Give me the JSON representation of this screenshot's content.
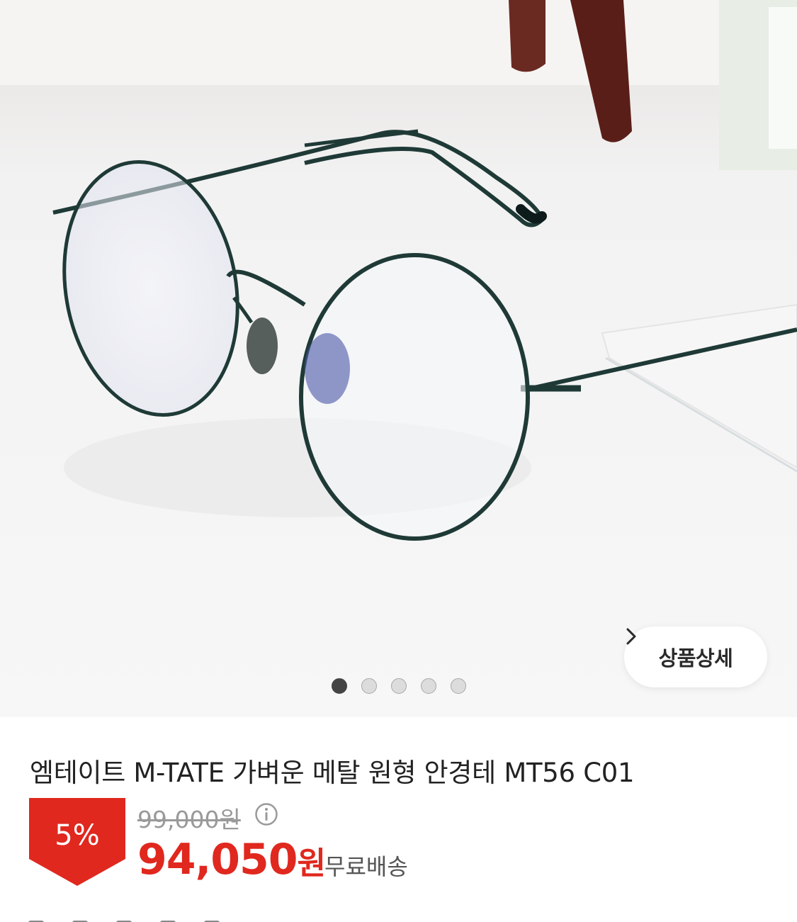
{
  "gallery": {
    "image_alt": "round metal eyeglasses",
    "detail_button_label": "상품상세",
    "dots": [
      {
        "active": true
      },
      {
        "active": false
      },
      {
        "active": false
      },
      {
        "active": false
      },
      {
        "active": false
      }
    ]
  },
  "product": {
    "title": "엠테이트 M-TATE 가벼운 메탈 원형 안경테 MT56 C01",
    "discount": "5%",
    "original_price": "99,000원",
    "price_number": "94,050",
    "price_unit": "원",
    "shipping": "무료배송"
  },
  "colors": {
    "discount": "#e0281e",
    "frame": "#1f3a36"
  }
}
